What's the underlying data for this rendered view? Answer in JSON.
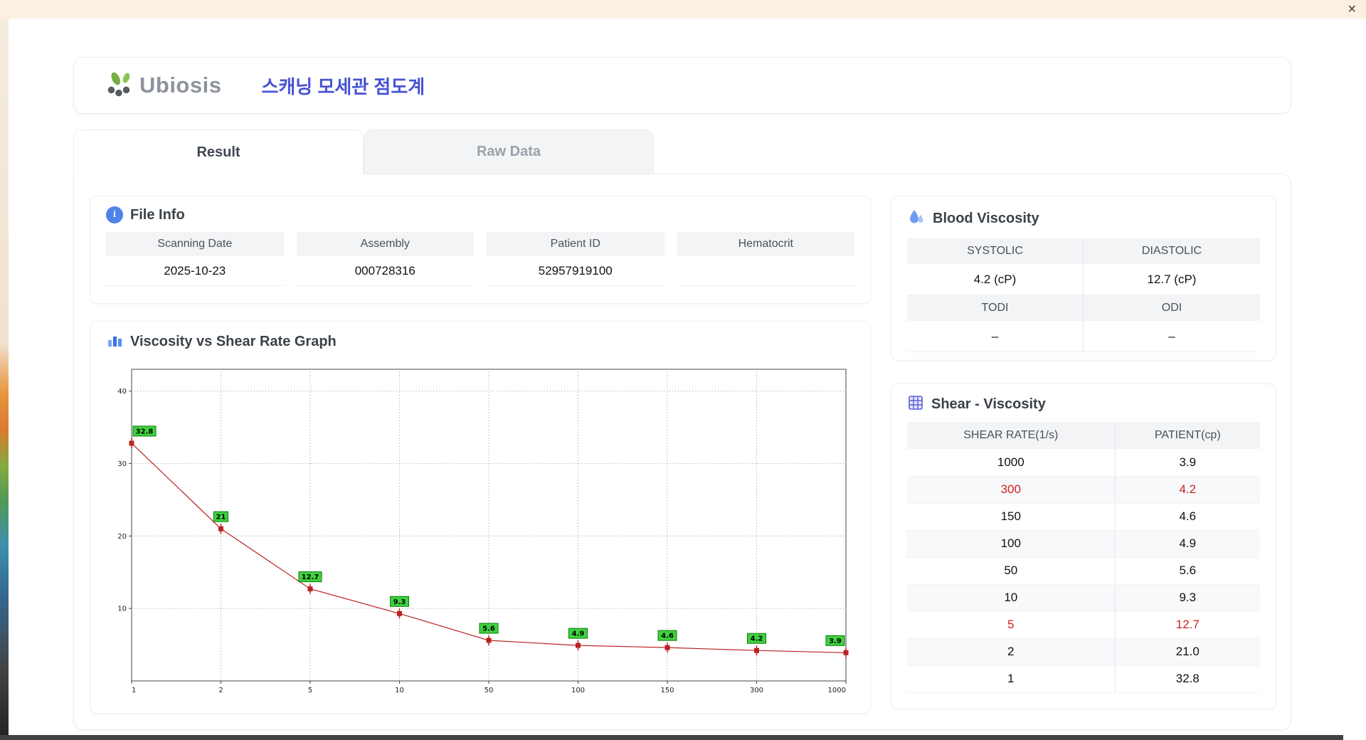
{
  "window": {
    "close_label": "×"
  },
  "header": {
    "brand": "Ubiosis",
    "title_ko": "스캐닝 모세관 점도계"
  },
  "tabs": [
    {
      "label": "Result",
      "active": true
    },
    {
      "label": "Raw Data",
      "active": false
    }
  ],
  "file_info": {
    "title": "File Info",
    "fields": [
      {
        "label": "Scanning Date",
        "value": "2025-10-23"
      },
      {
        "label": "Assembly",
        "value": "000728316"
      },
      {
        "label": "Patient ID",
        "value": "52957919100"
      },
      {
        "label": "Hematocrit",
        "value": ""
      }
    ]
  },
  "graph": {
    "title": "Viscosity vs Shear Rate Graph"
  },
  "chart_data": {
    "type": "line",
    "title": "Viscosity vs Shear Rate Graph",
    "x": [
      "1",
      "2",
      "5",
      "10",
      "50",
      "100",
      "150",
      "300",
      "1000"
    ],
    "x_scale": "categorical",
    "series": [
      {
        "name": "Patient",
        "values": [
          32.8,
          21,
          12.7,
          9.3,
          5.6,
          4.9,
          4.6,
          4.2,
          3.9
        ]
      }
    ],
    "point_labels": [
      "32.8",
      "21",
      "12.7",
      "9.3",
      "5.6",
      "4.9",
      "4.6",
      "4.2",
      "3.9"
    ],
    "yticks": [
      10,
      20,
      30,
      40
    ],
    "ylim": [
      0,
      43
    ],
    "grid": "dotted",
    "line_color": "#bb2222",
    "label_bg": "#3fd23f",
    "label_border": "#0b7a0b"
  },
  "blood_viscosity": {
    "title": "Blood Viscosity",
    "cells": [
      {
        "label": "SYSTOLIC",
        "value": "4.2 (cP)"
      },
      {
        "label": "DIASTOLIC",
        "value": "12.7 (cP)"
      },
      {
        "label": "TODI",
        "value": "–"
      },
      {
        "label": "ODI",
        "value": "–"
      }
    ]
  },
  "shear_table": {
    "title": "Shear - Viscosity",
    "columns": [
      "SHEAR RATE(1/s)",
      "PATIENT(cp)"
    ],
    "rows": [
      {
        "rate": "1000",
        "value": "3.9",
        "highlight": false
      },
      {
        "rate": "300",
        "value": "4.2",
        "highlight": true
      },
      {
        "rate": "150",
        "value": "4.6",
        "highlight": false
      },
      {
        "rate": "100",
        "value": "4.9",
        "highlight": false
      },
      {
        "rate": "50",
        "value": "5.6",
        "highlight": false
      },
      {
        "rate": "10",
        "value": "9.3",
        "highlight": false
      },
      {
        "rate": "5",
        "value": "12.7",
        "highlight": true
      },
      {
        "rate": "2",
        "value": "21.0",
        "highlight": false
      },
      {
        "rate": "1",
        "value": "32.8",
        "highlight": false
      }
    ]
  }
}
